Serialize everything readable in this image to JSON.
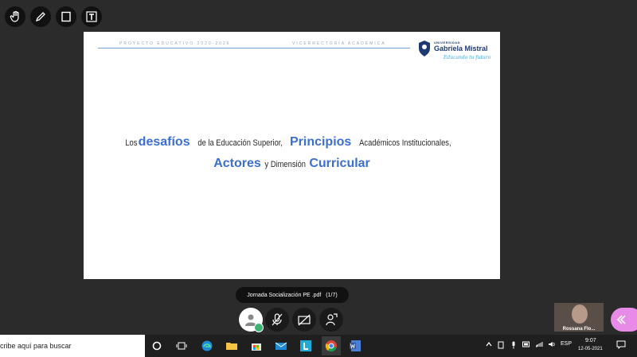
{
  "toolbar": {
    "tools": [
      {
        "name": "hand-tool-icon"
      },
      {
        "name": "pencil-tool-icon"
      },
      {
        "name": "rectangle-tool-icon"
      },
      {
        "name": "text-tool-icon"
      }
    ]
  },
  "slide": {
    "header_left": "PROYECTO EDUCATIVO 2020-2026",
    "header_mid": "VICERRECTORÍA ACADÉMICA",
    "logo_small": "UNIVERSIDAD",
    "logo_big": "Gabriela Mistral",
    "logo_script": "Educando tu futuro",
    "title_line1": [
      {
        "text": "Los ",
        "style": "sm"
      },
      {
        "text": "desafíos",
        "style": "hl"
      },
      {
        "text": " de la Educación Superior, ",
        "style": "sm"
      },
      {
        "text": "Principios",
        "style": "hl"
      },
      {
        "text": " Académicos Institucionales,",
        "style": "sm"
      }
    ],
    "title_line2": [
      {
        "text": "Actores",
        "style": "hl"
      },
      {
        "text": " y Dimensión ",
        "style": "sm"
      },
      {
        "text": "Curricular",
        "style": "hl"
      }
    ]
  },
  "file_pill": {
    "name": "Jornada Socialización PE .pdf",
    "pages": "(1/7)"
  },
  "meeting_controls": [
    "avatar",
    "mic-off-icon",
    "camera-off-icon",
    "share-person-icon"
  ],
  "participant": {
    "name": "Rossana Flo..."
  },
  "taskbar": {
    "search_placeholder": "cribe aquí para buscar",
    "language": "ESP",
    "time": "9:07",
    "date": "12-05-2021"
  },
  "colors": {
    "background": "#2b2b2b",
    "accent_blue": "#3b6fd0",
    "toggle_pink": "#e88be8"
  }
}
